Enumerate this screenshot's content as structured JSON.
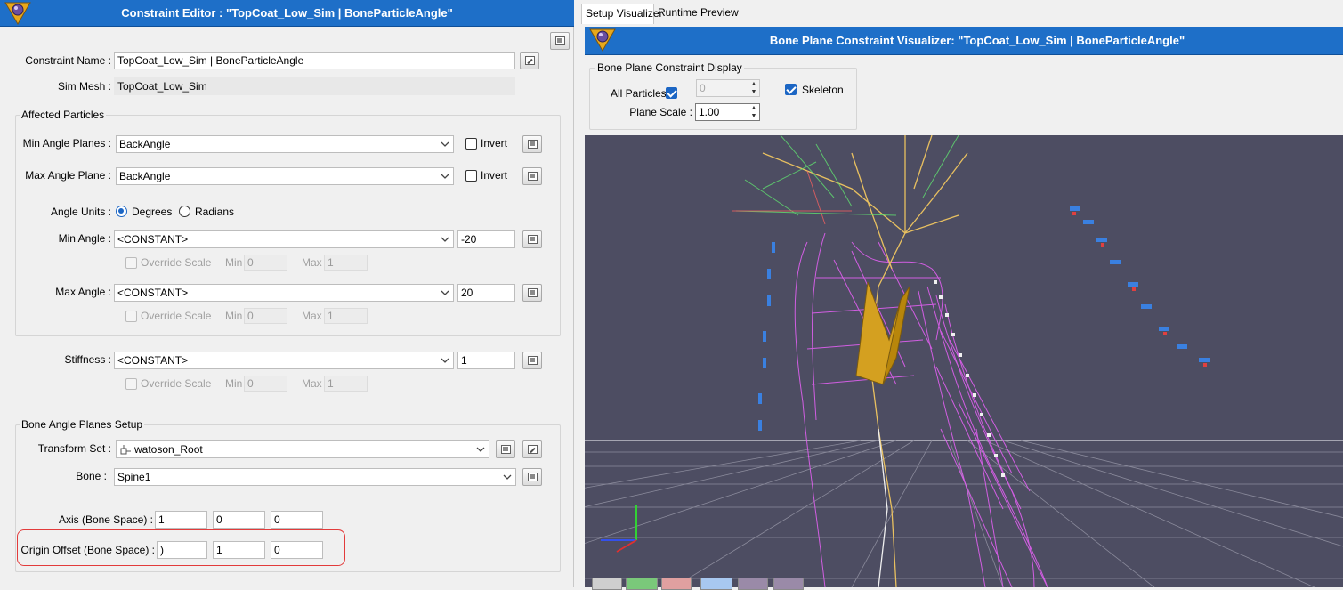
{
  "left": {
    "title": "Constraint Editor : \"TopCoat_Low_Sim | BoneParticleAngle\"",
    "constraint_name_label": "Constraint Name :",
    "constraint_name": "TopCoat_Low_Sim | BoneParticleAngle",
    "sim_mesh_label": "Sim Mesh :",
    "sim_mesh": "TopCoat_Low_Sim",
    "affected_particles": {
      "title": "Affected Particles",
      "min_angle_planes_label": "Min Angle Planes :",
      "min_angle_planes": "BackAngle",
      "max_angle_plane_label": "Max Angle Plane :",
      "max_angle_plane": "BackAngle",
      "invert_label": "Invert",
      "angle_units_label": "Angle Units :",
      "degrees": "Degrees",
      "radians": "Radians",
      "min_angle_label": "Min Angle :",
      "min_angle_source": "<CONSTANT>",
      "min_angle_value": "-20",
      "max_angle_label": "Max Angle :",
      "max_angle_source": "<CONSTANT>",
      "max_angle_value": "20",
      "override_scale": "Override Scale",
      "min_label": "Min",
      "max_label": "Max",
      "min_value": "0",
      "max_value": "1"
    },
    "stiffness_label": "Stiffness :",
    "stiffness_source": "<CONSTANT>",
    "stiffness_value": "1",
    "bone_setup": {
      "title": "Bone Angle Planes Setup",
      "transform_set_label": "Transform Set :",
      "transform_set": "watoson_Root",
      "bone_label": "Bone :",
      "bone": "Spine1",
      "axis_label": "Axis (Bone Space) :",
      "axis": [
        "1",
        "0",
        "0"
      ],
      "origin_label": "Origin Offset (Bone Space) :",
      "origin": [
        ")",
        "1",
        "0"
      ]
    }
  },
  "right": {
    "tabs": [
      "Setup Visualizer",
      "Runtime Preview"
    ],
    "title": "Bone Plane Constraint Visualizer: \"TopCoat_Low_Sim | BoneParticleAngle\"",
    "display_group": "Bone Plane Constraint Display",
    "all_particles_label": "All Particles",
    "all_particles_value": "0",
    "skeleton_label": "Skeleton",
    "plane_scale_label": "Plane Scale :",
    "plane_scale_value": "1.00"
  },
  "colors": {
    "title_bar": "#1e6fc8",
    "viewport_bg": "#4d4d62",
    "highlight": "#e23b3b",
    "accent": "#1c66c4",
    "cloth_mesh": "#e060f0",
    "skeleton": "#e8c060"
  }
}
